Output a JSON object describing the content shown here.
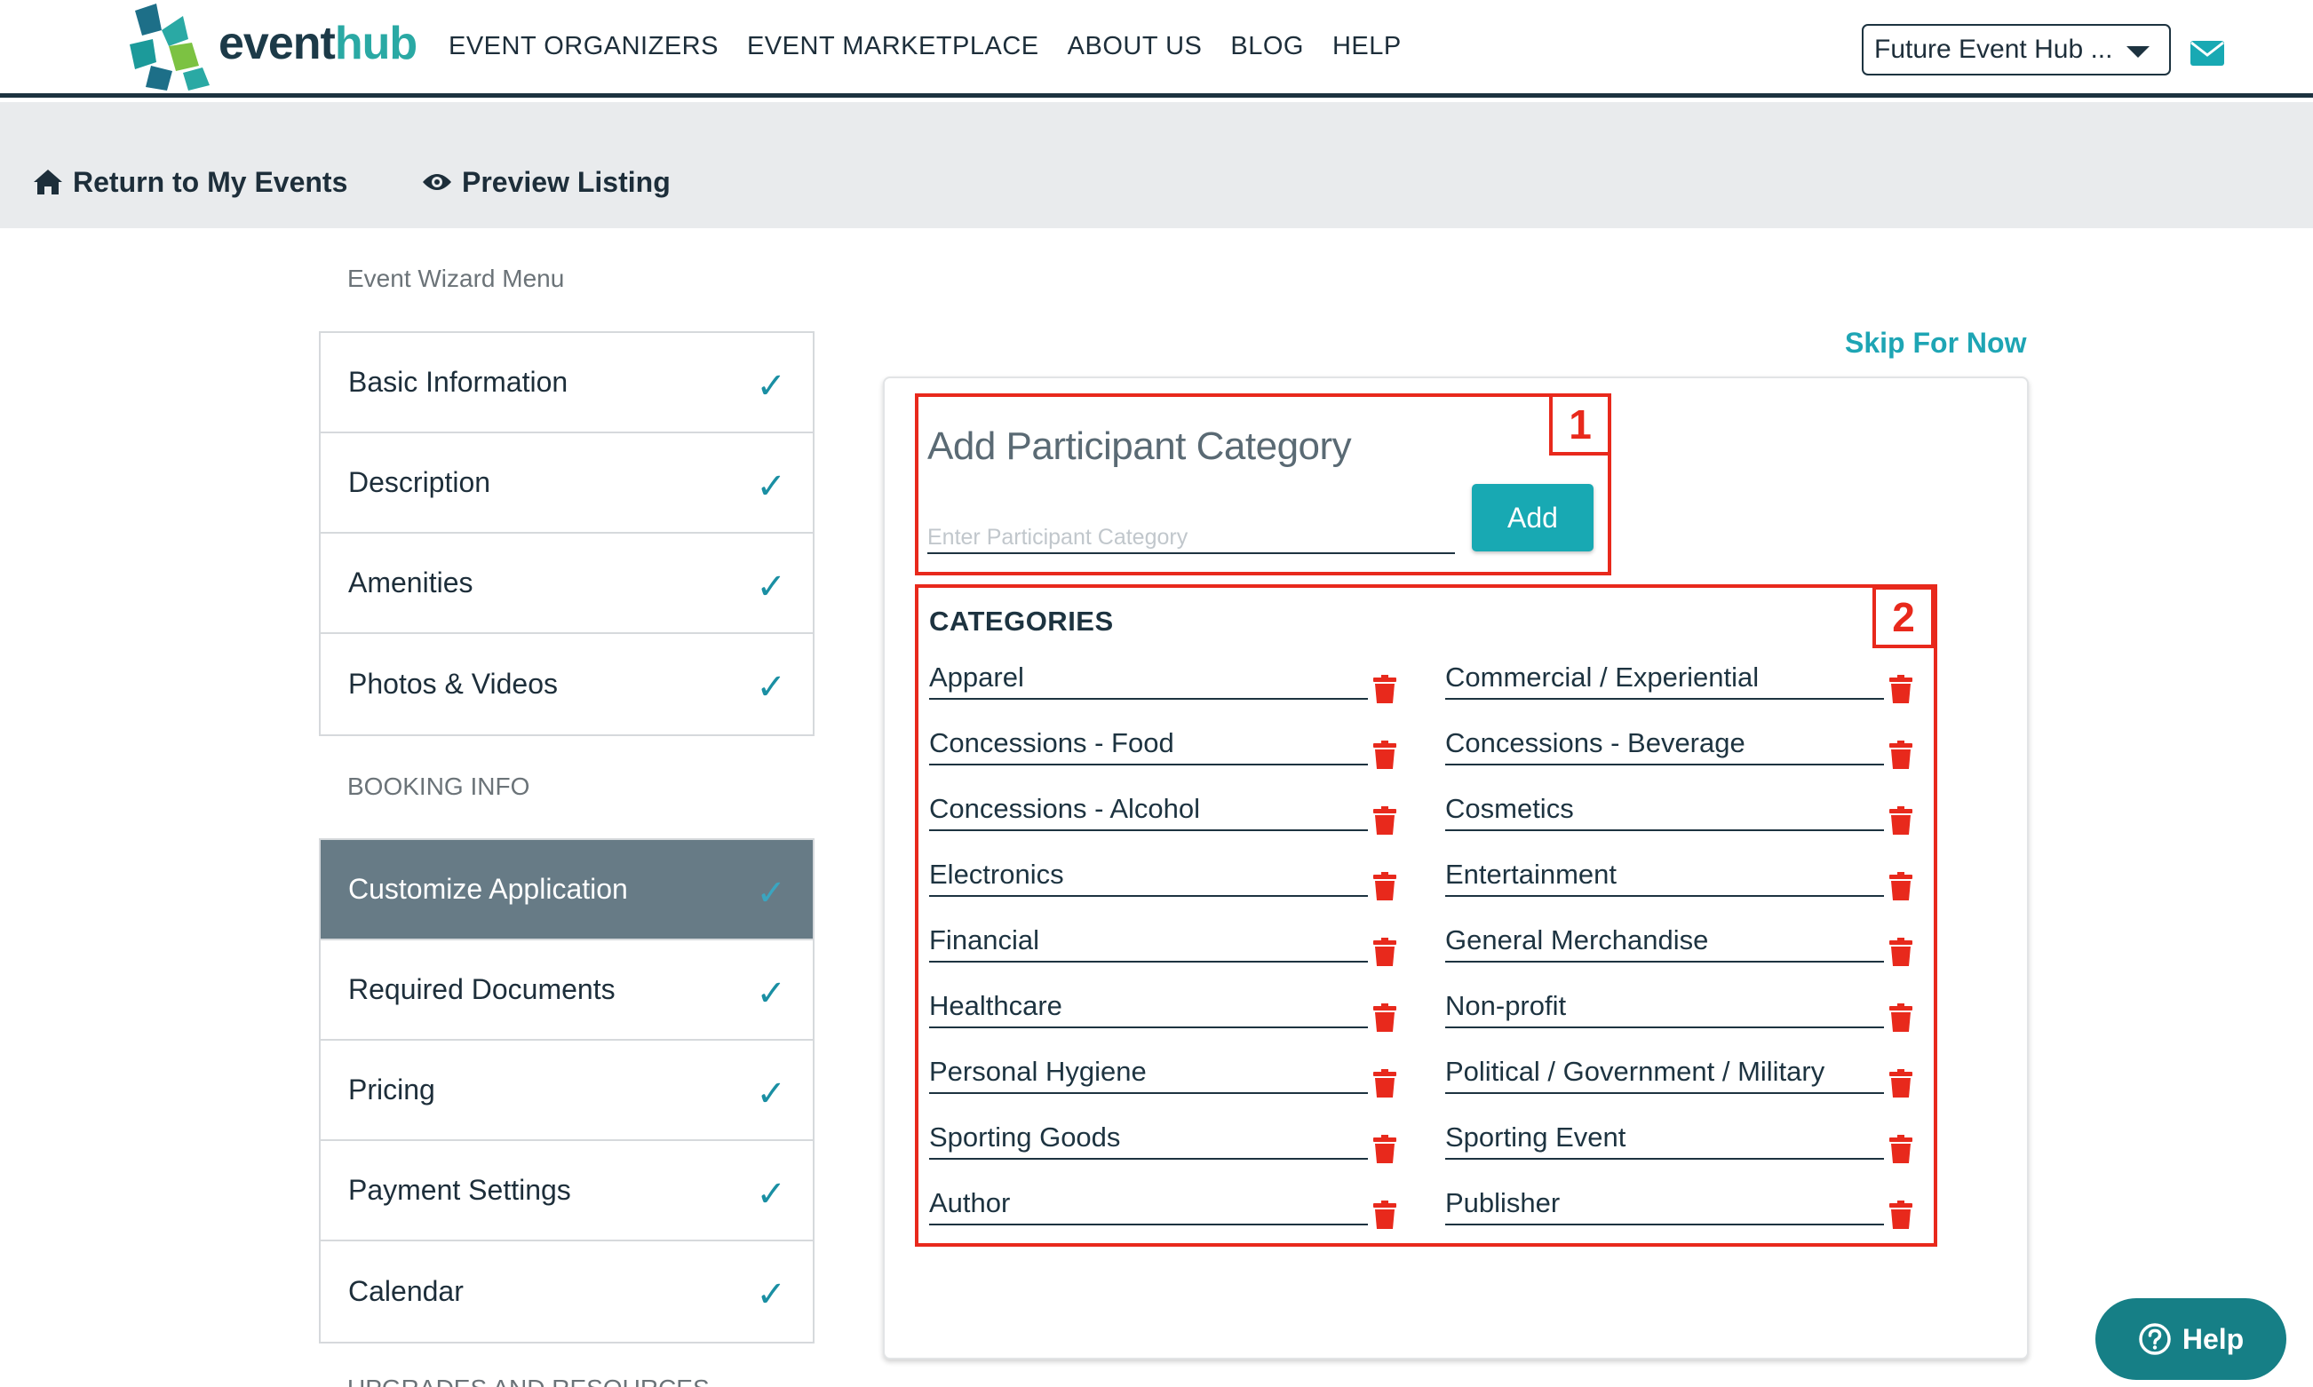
{
  "brand": {
    "name_part1": "event",
    "name_part2": "hub",
    "colors": {
      "navy": "#1d3340",
      "teal": "#18a9b3",
      "alert_red": "#e8291c"
    }
  },
  "nav": {
    "items": [
      "EVENT ORGANIZERS",
      "EVENT MARKETPLACE",
      "ABOUT US",
      "BLOG",
      "HELP"
    ]
  },
  "account": {
    "selected": "Future Event Hub ..."
  },
  "subbar": {
    "return_label": "Return to My Events",
    "preview_label": "Preview Listing"
  },
  "sidebar": {
    "menu_heading": "Event Wizard Menu",
    "wizard_items": [
      {
        "label": "Basic Information",
        "check": "✓"
      },
      {
        "label": "Description",
        "check": "✓"
      },
      {
        "label": "Amenities",
        "check": "✓"
      },
      {
        "label": "Photos & Videos",
        "check": "✓"
      }
    ],
    "booking_heading": "BOOKING INFO",
    "booking_items": [
      {
        "label": "Customize Application",
        "check": "✓",
        "active": true
      },
      {
        "label": "Required Documents",
        "check": "✓"
      },
      {
        "label": "Pricing",
        "check": "✓"
      },
      {
        "label": "Payment Settings",
        "check": "✓"
      },
      {
        "label": "Calendar",
        "check": "✓"
      }
    ],
    "clipped_heading": "UPGRADES AND RESOURCES"
  },
  "main": {
    "skip_label": "Skip For Now",
    "add_title": "Add Participant Category",
    "add_placeholder": "Enter Participant Category",
    "add_button": "Add",
    "categories_heading": "CATEGORIES",
    "categories_left": [
      "Apparel",
      "Concessions - Food",
      "Concessions - Alcohol",
      "Electronics",
      "Financial",
      "Healthcare",
      "Personal Hygiene",
      "Sporting Goods",
      "Author"
    ],
    "categories_right": [
      "Commercial / Experiential",
      "Concessions - Beverage",
      "Cosmetics",
      "Entertainment",
      "General Merchandise",
      "Non-profit",
      "Political / Government / Military",
      "Sporting Event",
      "Publisher"
    ]
  },
  "annotations": {
    "box1": "1",
    "box2": "2"
  },
  "help": {
    "label": "Help",
    "icon": "question-circle-icon"
  }
}
